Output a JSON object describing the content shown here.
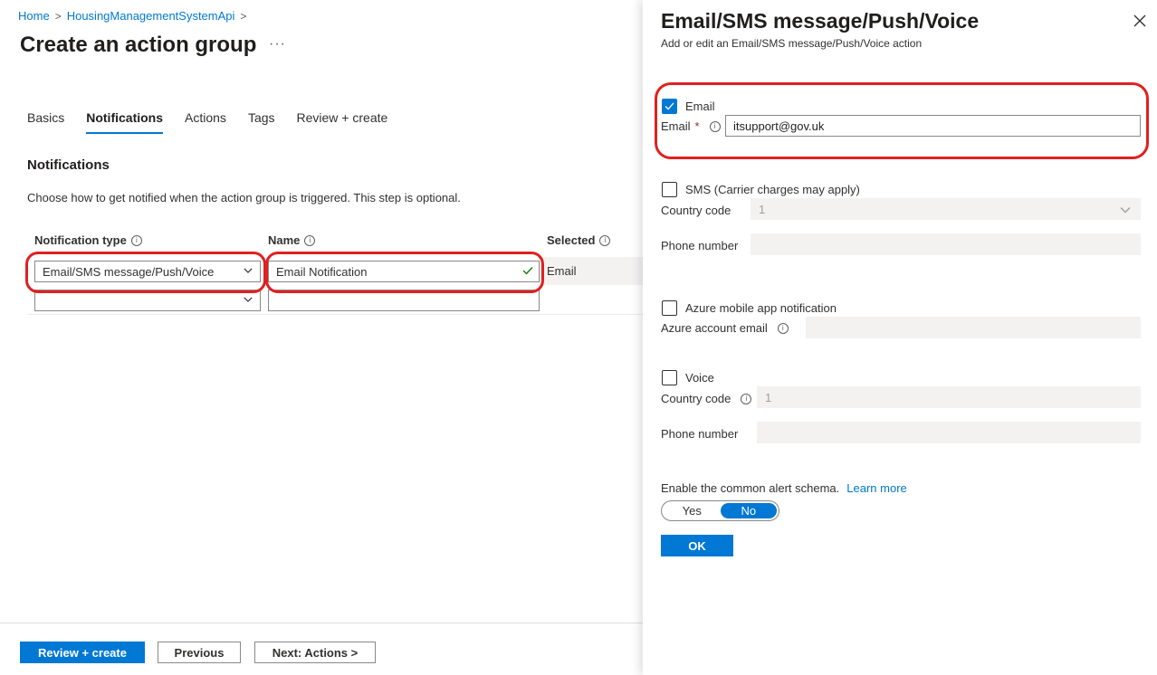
{
  "breadcrumb": {
    "home": "Home",
    "resource": "HousingManagementSystemApi"
  },
  "page": {
    "title": "Create an action group",
    "more": "···"
  },
  "tabs": [
    "Basics",
    "Notifications",
    "Actions",
    "Tags",
    "Review + create"
  ],
  "notifications": {
    "title": "Notifications",
    "description": "Choose how to get notified when the action group is triggered. This step is optional.",
    "columns": {
      "type": "Notification type",
      "name": "Name",
      "selected": "Selected"
    },
    "rows": [
      {
        "type": "Email/SMS message/Push/Voice",
        "name": "Email Notification",
        "selected": "Email"
      },
      {
        "type": "",
        "name": "",
        "selected": ""
      }
    ]
  },
  "footer": {
    "review": "Review + create",
    "previous": "Previous",
    "next": "Next: Actions >"
  },
  "panel": {
    "title": "Email/SMS message/Push/Voice",
    "subtitle": "Add or edit an Email/SMS message/Push/Voice action",
    "email": {
      "checkbox": "Email",
      "label": "Email",
      "required": "*",
      "value": "itsupport@gov.uk",
      "checked": true
    },
    "sms": {
      "checkbox": "SMS (Carrier charges may apply)",
      "country_label": "Country code",
      "country_value": "1",
      "phone_label": "Phone number"
    },
    "push": {
      "checkbox": "Azure mobile app notification",
      "account_label": "Azure account email"
    },
    "voice": {
      "checkbox": "Voice",
      "country_label": "Country code",
      "country_value": "1",
      "phone_label": "Phone number"
    },
    "schema": {
      "label": "Enable the common alert schema.",
      "link": "Learn more",
      "yes": "Yes",
      "no": "No",
      "selected": "No"
    },
    "ok": "OK"
  },
  "colors": {
    "accent": "#0078d4",
    "highlight": "#e02020"
  }
}
